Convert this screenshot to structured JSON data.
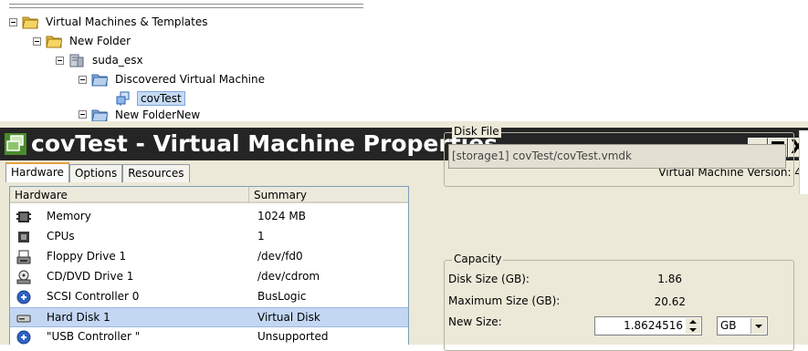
{
  "tree": {
    "items": [
      {
        "label": "Virtual Machines & Templates",
        "icon": "folder-icon"
      },
      {
        "label": "New Folder",
        "icon": "folder-icon"
      },
      {
        "label": "suda_esx",
        "icon": "host-server-icon"
      },
      {
        "label": "Discovered Virtual Machine",
        "icon": "folder-icon"
      },
      {
        "label": "covTest",
        "icon": "virtual-machine-icon"
      },
      {
        "label": "New FolderNew",
        "icon": "folder-icon"
      }
    ]
  },
  "window": {
    "title": "covTest - Virtual Machine Properties",
    "title_bg": "#252525",
    "controls": {
      "close_glyph": "X"
    },
    "tabs": [
      {
        "label": "Hardware",
        "active": true
      },
      {
        "label": "Options",
        "active": false
      },
      {
        "label": "Resources",
        "active": false
      }
    ],
    "vm_version": "Virtual Machine Version: 4"
  },
  "hardware": {
    "columns": [
      "Hardware",
      "Summary"
    ],
    "rows": [
      {
        "name": "Memory",
        "summary": "1024 MB",
        "icon": "memory-icon"
      },
      {
        "name": "CPUs",
        "summary": "1",
        "icon": "cpu-icon"
      },
      {
        "name": "Floppy Drive 1",
        "summary": "/dev/fd0",
        "icon": "floppy-drive-icon"
      },
      {
        "name": "CD/DVD Drive 1",
        "summary": "/dev/cdrom",
        "icon": "cd-dvd-drive-icon"
      },
      {
        "name": "SCSI Controller 0",
        "summary": "BusLogic",
        "icon": "scsi-controller-icon"
      },
      {
        "name": "Hard Disk 1",
        "summary": "Virtual Disk",
        "icon": "hard-disk-icon",
        "selected": true
      },
      {
        "name": "\"USB Controller \"",
        "summary": "Unsupported",
        "icon": "usb-controller-icon"
      }
    ],
    "selected_color": "#c3d7f3"
  },
  "disk_file": {
    "title": "Disk File",
    "value": "[storage1] covTest/covTest.vmdk"
  },
  "capacity": {
    "title": "Capacity",
    "disk_size_label": "Disk Size (GB):",
    "disk_size_value": "1.86",
    "max_size_label": "Maximum Size (GB):",
    "max_size_value": "20.62",
    "new_size_label": "New Size:",
    "new_size_value": "1.8624516",
    "unit": "GB"
  }
}
